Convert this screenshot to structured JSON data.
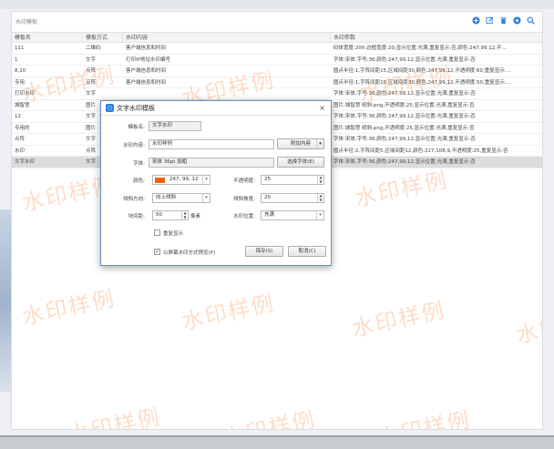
{
  "panel": {
    "title": "水印模板"
  },
  "toolbar": {
    "icons": [
      "add-icon",
      "edit-icon",
      "delete-icon",
      "preview-icon",
      "search-icon"
    ]
  },
  "grid": {
    "headers": [
      "模板名",
      "模板方式",
      "水印内容",
      "水印参数"
    ],
    "rows": [
      [
        "111",
        "二维码",
        "客户端信息和时间",
        "码体宽度:200,边框宽度:20,显示位置:光满,重复显示:否,颜色:247,99,12,不..."
      ],
      [
        "1",
        "文字",
        "打印IP地址水印编号",
        "字体:宋体,字号:36,颜色:247,99,12,显示位置:光满,重复显示:否"
      ],
      [
        "8,10",
        "点阵",
        "客户端信息和时间",
        "圆点半径:1,字阵间距15,区域间距30,颜色:247,99,12,不透明度:60,重复显示:..."
      ],
      [
        "专用",
        "点阵",
        "客户端信息和时间",
        "圆点半径:1,字阵间距10,区域间距30,颜色:247,99,12,不透明度:50,重复显示:..."
      ],
      [
        "打印水印",
        "文字",
        "",
        "字体:宋体,字号:36,颜色:247,99,12,显示位置:光满,重复显示:否"
      ],
      [
        "城智慧",
        "图片",
        "",
        "图片:城智慧 纸斜.png,不透明度:25,显示位置:光满,重复显示:否"
      ],
      [
        "12",
        "文字",
        "",
        "字体:宋体,字号:36,颜色:247,99,12,显示位置:光满,重复显示:否"
      ],
      [
        "专用的",
        "图片",
        "",
        "图片:城智慧 纸斜.png,不透明度:25,显示位置:光满,重复显示:否"
      ],
      [
        "点阵",
        "文字",
        "",
        "字体:宋体,字号:36,颜色:247,99,12,显示位置:光满,重复显示:否"
      ],
      [
        "水印",
        "点阵",
        "",
        "圆点半径:2,字阵间距5,区域间距12,颜色:227,108,9,不透明度:25,重复显示:否"
      ],
      [
        "文字水印",
        "文字",
        "",
        "字体:宋体,字号:36,颜色:247,99,12,显示位置:光满,重复显示:否"
      ]
    ]
  },
  "watermark": {
    "text": "水印样例",
    "color": "#f7630c"
  },
  "dialog": {
    "title": "文字水印模板",
    "close": "×",
    "template_name_label": "模板名:",
    "template_name_value": "文字水印",
    "content_label": "水印内容:",
    "content_value": "水印样例",
    "add_content_button": "附加内容",
    "font_label": "字体:",
    "font_value": "宋体 36pt 加粗",
    "choose_font_button": "选择字体(E)",
    "color_label": "颜色:",
    "color_value": "247, 99, 12",
    "color_swatch": "#f7630c",
    "opacity_label": "不透明度:",
    "opacity_value": "25",
    "tilt_dir_label": "倾斜方向:",
    "tilt_dir_value": "向上倾斜",
    "tilt_angle_label": "倾斜角度:",
    "tilt_angle_value": "20",
    "spacing_label": "块间距:",
    "spacing_value": "50",
    "spacing_unit": "像素",
    "position_label": "水印位置:",
    "position_value": "充满",
    "repeat_label": "重复显示",
    "screen_label": "以屏幕水印方式预览(P)",
    "save_button": "保存(S)",
    "cancel_button": "取消(C)"
  }
}
